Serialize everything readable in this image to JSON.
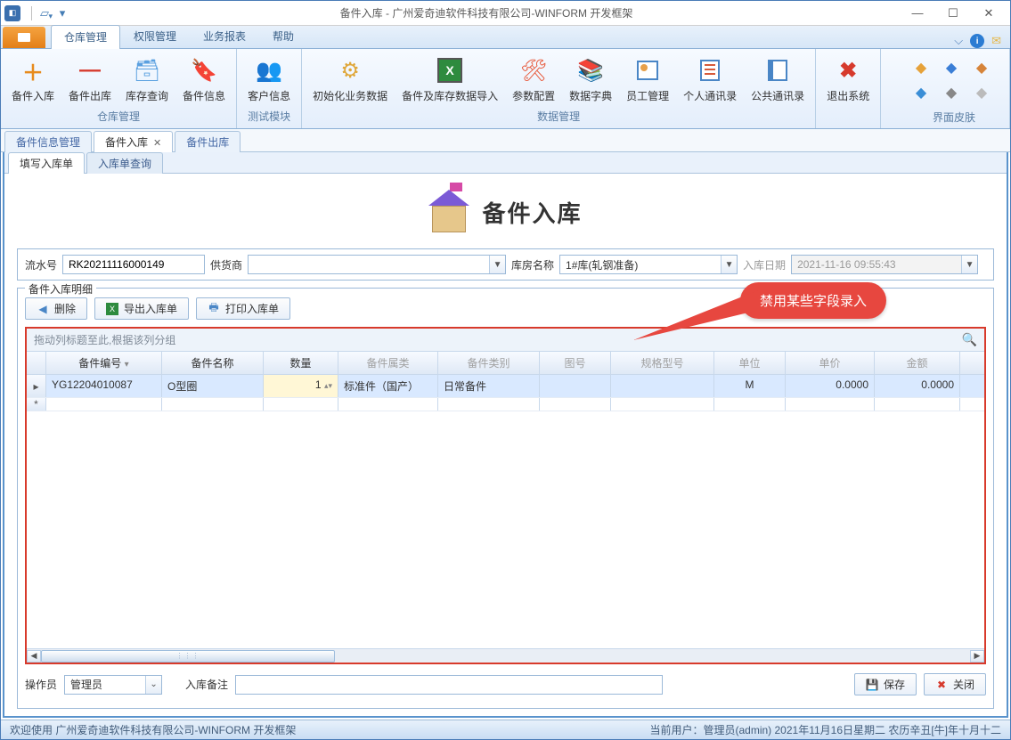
{
  "title": "备件入库 - 广州爱奇迪软件科技有限公司-WINFORM 开发框架",
  "ribbon": {
    "tabs": [
      "仓库管理",
      "权限管理",
      "业务报表",
      "帮助"
    ],
    "groups": {
      "warehouse": {
        "label": "仓库管理",
        "buttons": [
          "备件入库",
          "备件出库",
          "库存查询",
          "备件信息"
        ]
      },
      "test": {
        "label": "测试模块",
        "buttons": [
          "客户信息"
        ]
      },
      "data": {
        "label": "数据管理",
        "buttons": [
          "初始化业务数据",
          "备件及库存数据导入",
          "参数配置",
          "数据字典",
          "员工管理",
          "个人通讯录",
          "公共通讯录"
        ]
      },
      "exit": {
        "button": "退出系统"
      },
      "skin": {
        "label": "界面皮肤"
      }
    }
  },
  "docTabs": [
    {
      "label": "备件信息管理",
      "active": false,
      "closable": false
    },
    {
      "label": "备件入库",
      "active": true,
      "closable": true
    },
    {
      "label": "备件出库",
      "active": false,
      "closable": false
    }
  ],
  "subTabs": [
    {
      "label": "填写入库单",
      "active": true
    },
    {
      "label": "入库单查询",
      "active": false
    }
  ],
  "page": {
    "heading": "备件入库",
    "form": {
      "serialLabel": "流水号",
      "serial": "RK20211116000149",
      "supplierLabel": "供货商",
      "supplier": "",
      "warehouseLabel": "库房名称",
      "warehouse": "1#库(轧钢准备)",
      "dateLabel": "入库日期",
      "date": "2021-11-16 09:55:43"
    },
    "groupTitle": "备件入库明细",
    "toolbar": {
      "delete": "删除",
      "export": "导出入库单",
      "print": "打印入库单"
    },
    "grid": {
      "groupHint": "拖动列标题至此,根据该列分组",
      "columns": [
        "备件编号",
        "备件名称",
        "数量",
        "备件属类",
        "备件类别",
        "图号",
        "规格型号",
        "单位",
        "单价",
        "金额"
      ],
      "rows": [
        {
          "code": "YG12204010087",
          "name": "O型圈",
          "qty": "1",
          "cls": "标准件（国产）",
          "cat": "日常备件",
          "draw": "",
          "spec": "",
          "unit": "M",
          "price": "0.0000",
          "amount": "0.0000"
        }
      ]
    },
    "annotation": "禁用某些字段录入",
    "bottom": {
      "operatorLabel": "操作员",
      "operator": "管理员",
      "remarkLabel": "入库备注",
      "save": "保存",
      "close": "关闭"
    }
  },
  "status": {
    "left": "欢迎使用 广州爱奇迪软件科技有限公司-WINFORM 开发框架",
    "right": "当前用户：管理员(admin)   2021年11月16日星期二 农历辛丑[牛]年十月十二"
  }
}
